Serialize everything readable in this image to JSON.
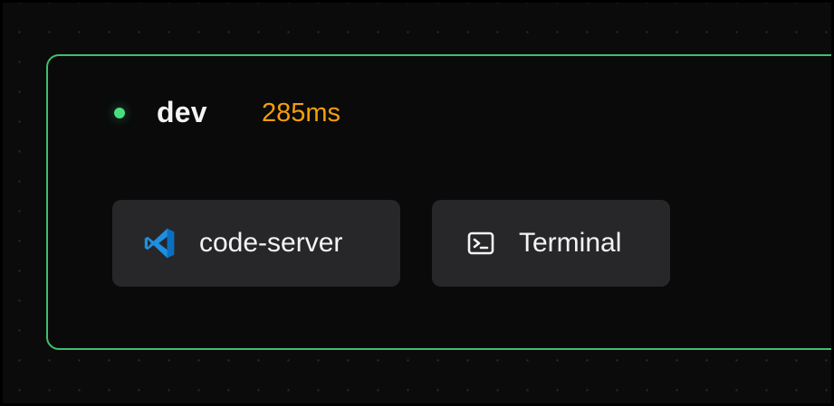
{
  "workspace": {
    "status": "online",
    "status_color": "#4ade80",
    "name": "dev",
    "latency": "285ms",
    "latency_color": "#f59e0b",
    "border_color": "#3fbf6c"
  },
  "apps": [
    {
      "label": "code-server",
      "icon": "vscode-icon",
      "icon_color": "#1e8fe1"
    },
    {
      "label": "Terminal",
      "icon": "terminal-icon",
      "icon_color": "#f4f4f5"
    }
  ]
}
